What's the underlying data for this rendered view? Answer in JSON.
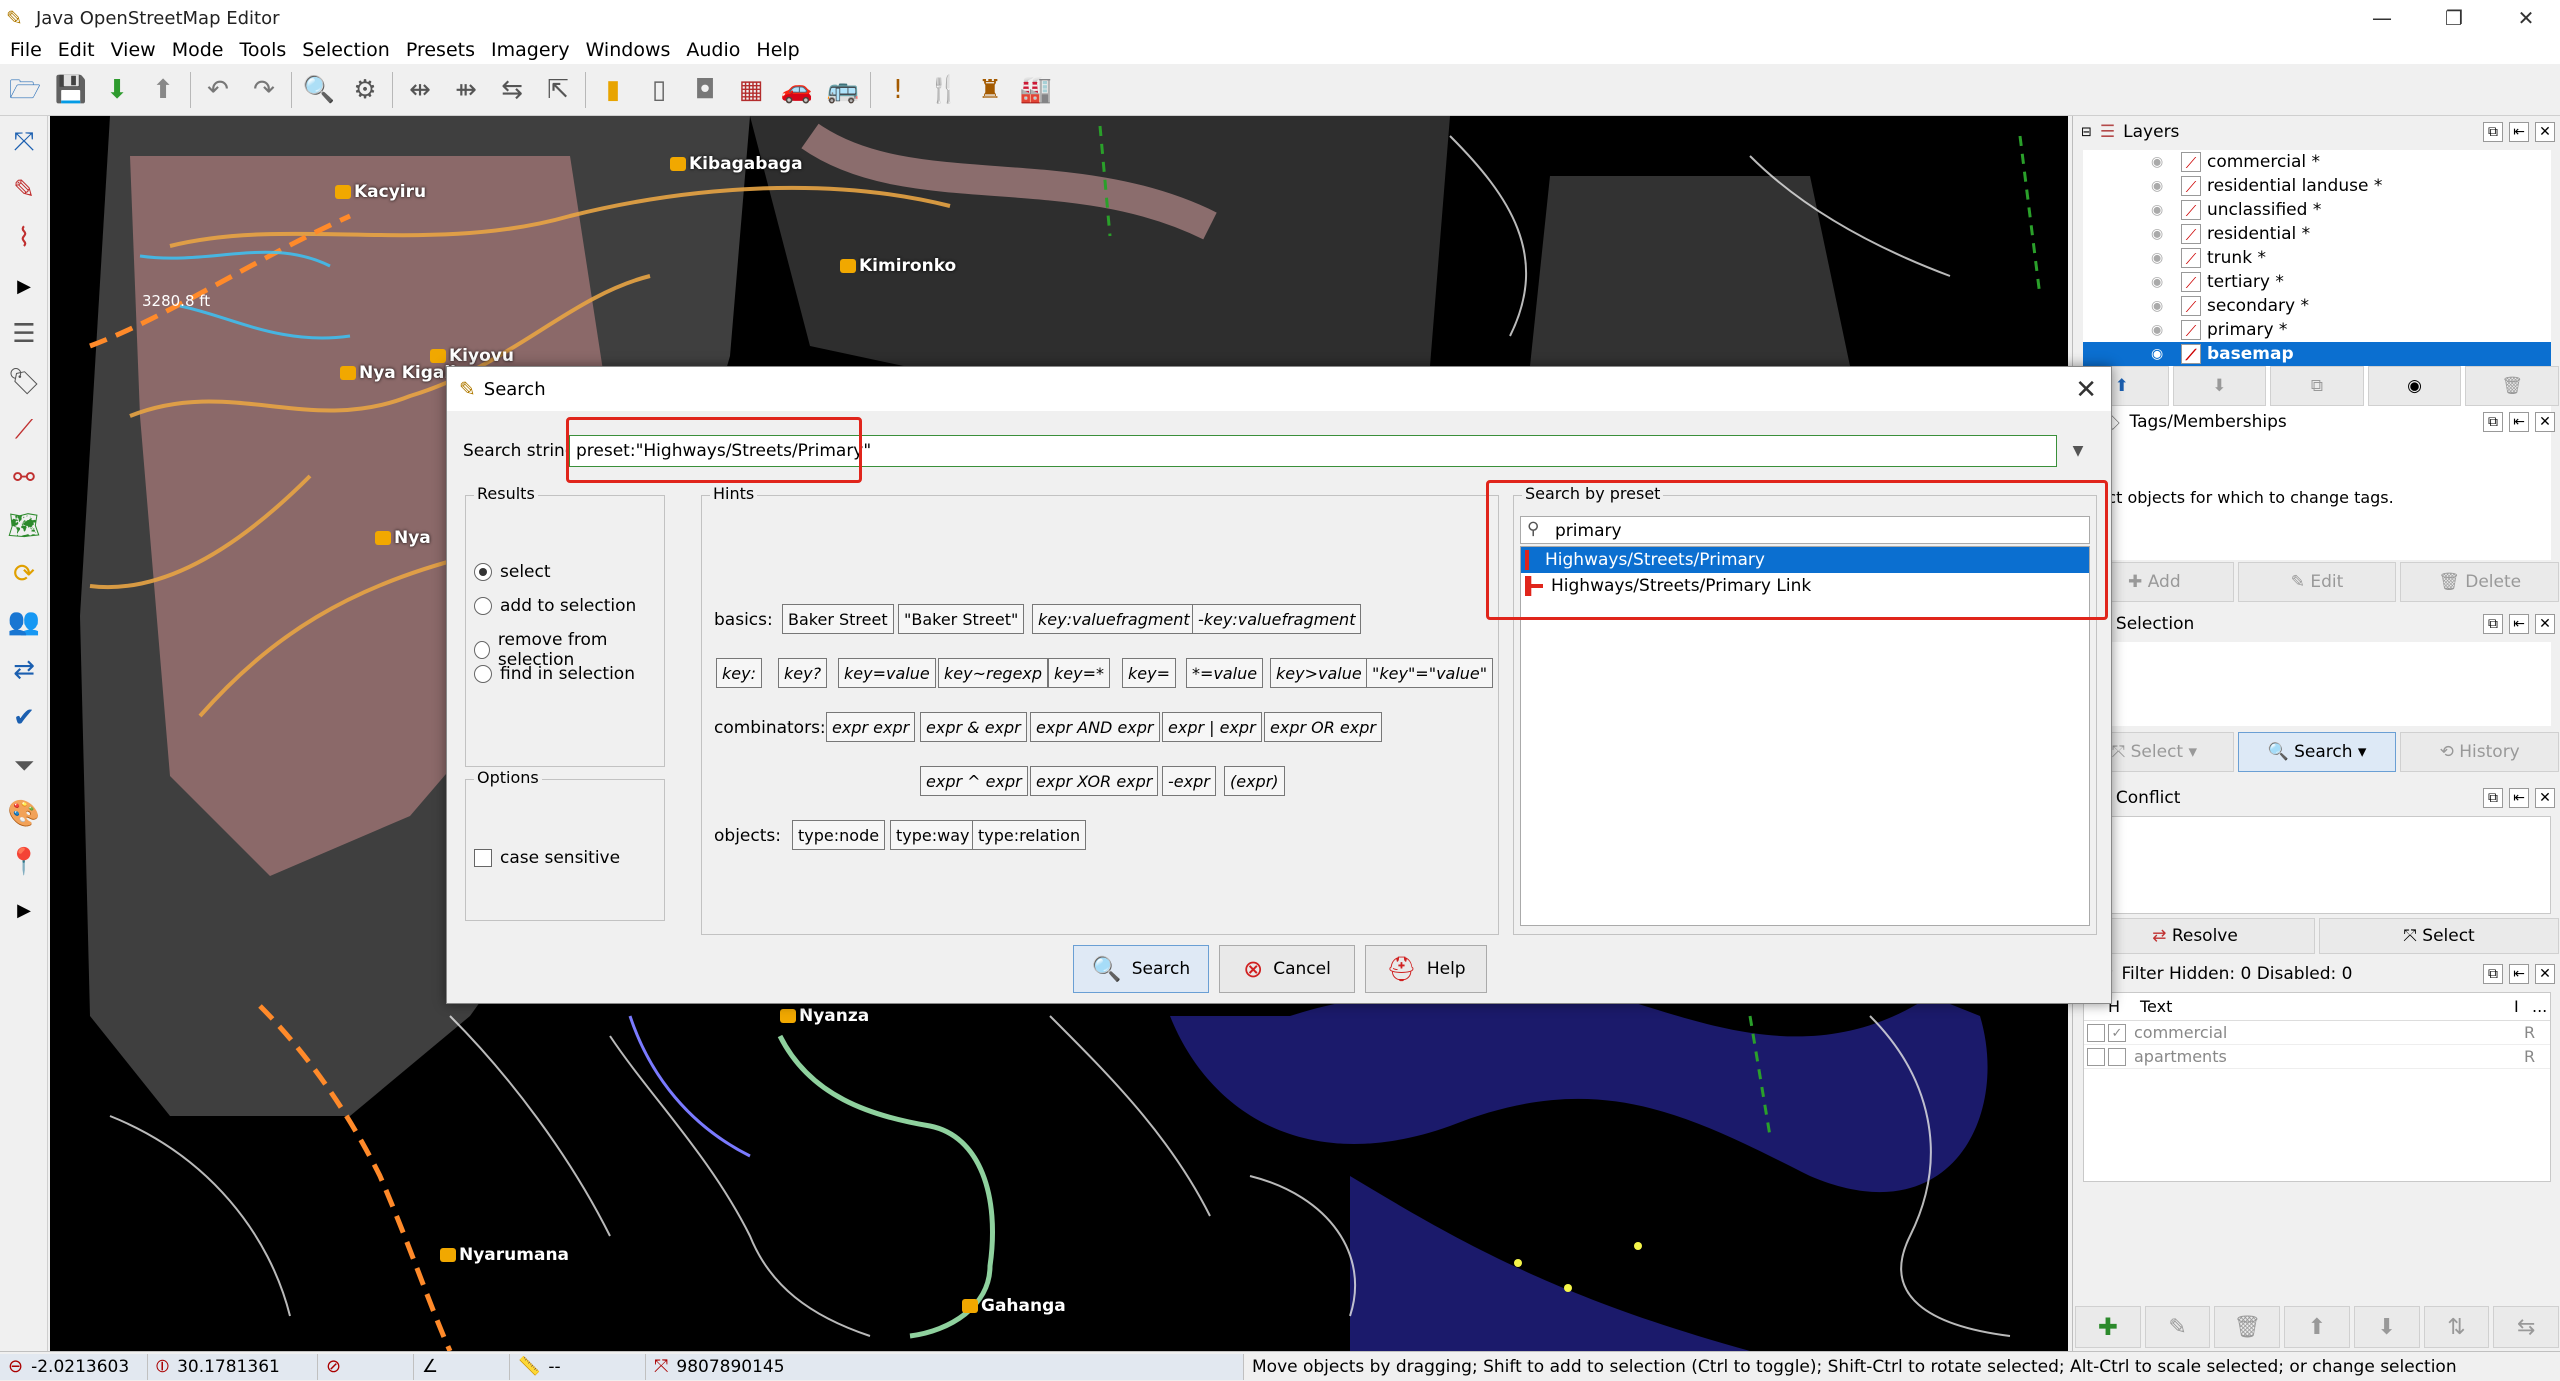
{
  "window": {
    "title": "Java OpenStreetMap Editor",
    "minimize": "—",
    "maximize": "❐",
    "close": "✕"
  },
  "menu": [
    "File",
    "Edit",
    "View",
    "Mode",
    "Tools",
    "Selection",
    "Presets",
    "Imagery",
    "Windows",
    "Audio",
    "Help"
  ],
  "map": {
    "scale": "3280.8 ft",
    "places": [
      "Kibagabaga",
      "Kacyiru",
      "Kimironko",
      "Kiyovu",
      "Nya Kigali",
      "Nya",
      "Nyanza",
      "Nyarumana",
      "Gahanga"
    ]
  },
  "search_dialog": {
    "title": "Search",
    "search_label": "Search string:",
    "search_value": "preset:\"Highways/Streets/Primary\"",
    "results": {
      "title": "Results",
      "options": [
        "select",
        "add to selection",
        "remove from selection",
        "find in selection"
      ],
      "selected": "select"
    },
    "options": {
      "title": "Options",
      "case_sensitive": "case sensitive"
    },
    "hints": {
      "title": "Hints",
      "basics_label": "basics:",
      "basics": [
        "Baker Street",
        "\"Baker Street\"",
        "key:valuefragment",
        "-key:valuefragment"
      ],
      "keys": [
        "key:",
        "key?",
        "key=value",
        "key~regexp",
        "key=*",
        "key=",
        "*=value",
        "key>value",
        "\"key\"=\"value\""
      ],
      "combinators_label": "combinators:",
      "combinators_row1": [
        "expr expr",
        "expr & expr",
        "expr AND expr",
        "expr | expr",
        "expr OR expr"
      ],
      "combinators_row2": [
        "expr ^ expr",
        "expr XOR expr",
        "-expr",
        "(expr)"
      ],
      "objects_label": "objects:",
      "objects": [
        "type:node",
        "type:way",
        "type:relation"
      ]
    },
    "preset": {
      "title": "Search by preset",
      "filter_value": "primary",
      "items": [
        "Highways/Streets/Primary",
        "Highways/Streets/Primary Link"
      ],
      "selected_index": 0
    },
    "buttons": {
      "search": "Search",
      "cancel": "Cancel",
      "help": "Help"
    }
  },
  "layers_panel": {
    "title": "Layers",
    "layers": [
      "commercial *",
      "residential landuse *",
      "unclassified *",
      "residential *",
      "trunk *",
      "tertiary *",
      "secondary *",
      "primary *",
      "basemap"
    ],
    "active_index": 8
  },
  "tags_panel": {
    "title": "Tags/Memberships",
    "hint": "lect objects for which to change tags.",
    "buttons": [
      "Add",
      "Edit",
      "Delete"
    ]
  },
  "selection_panel": {
    "title": "Selection",
    "buttons": [
      "Select",
      "Search",
      "History"
    ]
  },
  "conflict_panel": {
    "title": "Conflict",
    "buttons": [
      "Resolve",
      "Select"
    ]
  },
  "filter_panel": {
    "title": "Filter Hidden: 0 Disabled: 0",
    "columns": [
      "H",
      "Text",
      "I",
      "..."
    ],
    "rows": [
      {
        "text": "commercial",
        "flag": "R"
      },
      {
        "text": "apartments",
        "flag": "R"
      }
    ]
  },
  "status": {
    "lat": "-2.0213603",
    "lon": "30.1781361",
    "heading": "",
    "angle": "",
    "distance": "--",
    "id": "9807890145",
    "message": "Move objects by dragging; Shift to add to selection (Ctrl to toggle); Shift-Ctrl to rotate selected; Alt-Ctrl to scale selected; or change selection"
  },
  "colors": {
    "accent": "#0b6fd0",
    "highlight_box": "#e0251b",
    "map_bg": "#000000",
    "roads": "#e8a444",
    "buildings": "#d9a3a3",
    "water": "#1b1a6b"
  }
}
